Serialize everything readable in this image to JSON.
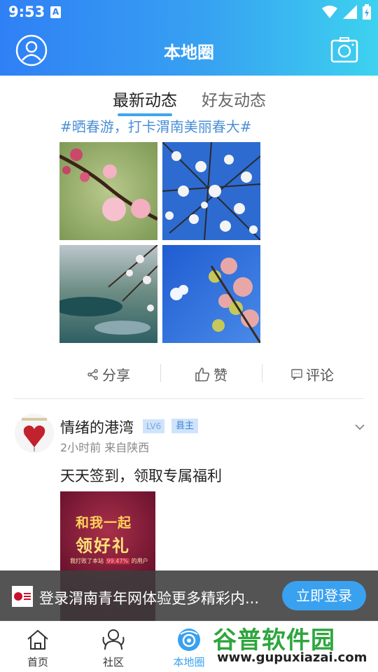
{
  "status_bar": {
    "time": "9:53"
  },
  "header": {
    "title": "本地圈"
  },
  "tabs": {
    "latest": "最新动态",
    "friends": "好友动态"
  },
  "post1": {
    "hashtag": "#晒春游，打卡渭南美丽春大#",
    "actions": {
      "share": "分享",
      "like": "赞",
      "comment": "评论"
    }
  },
  "post2": {
    "author": "情绪的港湾",
    "level_badge": "LV6",
    "role_badge": "县主",
    "meta": "2小时前  来自陕西",
    "text": "天天签到，领取专属福利",
    "promo": {
      "line1": "和我一起",
      "line2": "领好礼",
      "small_prefix": "我打败了本站",
      "small_pct": "99.47%",
      "small_suffix": "的用户"
    }
  },
  "login_banner": {
    "text": "登录渭南青年网体验更多精彩内...",
    "button": "立即登录"
  },
  "bottom_nav": {
    "home": "首页",
    "community": "社区",
    "local": "本地圈"
  },
  "watermark": {
    "title": "谷普软件园",
    "url": "www.gupuxiazai.com"
  },
  "colors": {
    "accent": "#3aa1f0",
    "header_start": "#2f80f5",
    "header_end": "#3dd2ef",
    "hashtag": "#4b8fd6"
  }
}
